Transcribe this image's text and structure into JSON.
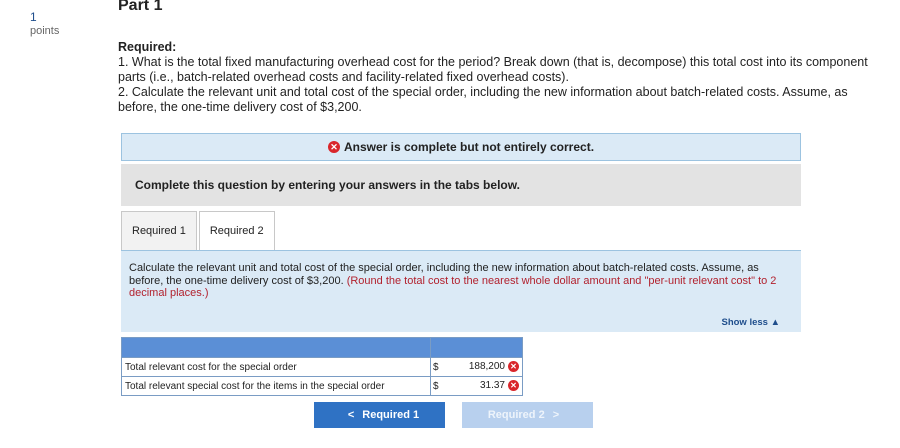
{
  "question": {
    "number": "1",
    "points_label": "points"
  },
  "part_title": "Part 1",
  "required": {
    "heading": "Required:",
    "item1": "1. What is the total fixed manufacturing overhead cost for the period? Break down (that is, decompose) this total cost into its component parts (i.e., batch-related overhead costs and facility-related fixed overhead costs).",
    "item2": "2. Calculate the relevant unit and total cost of the special order, including the new information about batch-related costs. Assume, as before, the one-time delivery cost of $3,200."
  },
  "banner": {
    "icon": "x-circle-icon",
    "text": "Answer is complete but not entirely correct."
  },
  "instructions": "Complete this question by entering your answers in the tabs below.",
  "tabs": [
    {
      "label": "Required 1",
      "active": false
    },
    {
      "label": "Required 2",
      "active": true
    }
  ],
  "panel": {
    "text": "Calculate the relevant unit and total cost of the special order, including the new information about batch-related costs. Assume, as before, the one-time delivery cost of $3,200. ",
    "note": "(Round the total cost to the nearest whole dollar amount and \"per-unit relevant cost\" to 2 decimal places.)",
    "show_less": "Show less",
    "show_less_icon": "▲"
  },
  "answers": {
    "rows": [
      {
        "label": "Total relevant cost for the special order",
        "currency": "$",
        "value": "188,200",
        "status": "incorrect"
      },
      {
        "label": "Total relevant special cost for the items in the special order",
        "currency": "$",
        "value": "31.37",
        "status": "incorrect"
      }
    ]
  },
  "nav": {
    "prev_label": "Required 1",
    "prev_icon": "<",
    "next_label": "Required 2",
    "next_icon": ">"
  },
  "colors": {
    "incorrect": "#d9262b",
    "accent": "#2f72c4",
    "panel_bg": "#dbeaf6",
    "note_text": "#b2222e"
  }
}
